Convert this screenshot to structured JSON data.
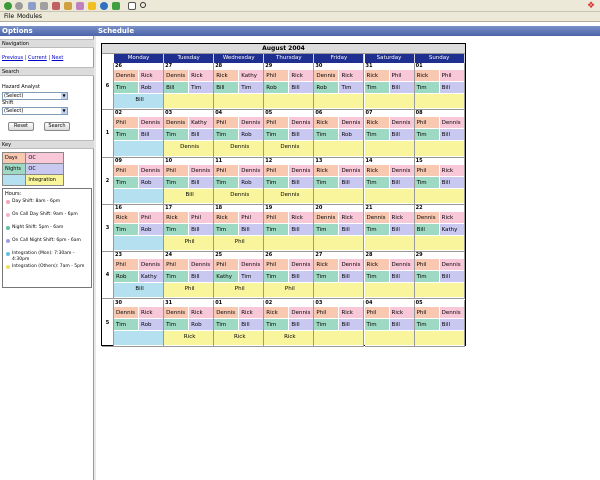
{
  "menu": {
    "file": "File",
    "modules": "Modules"
  },
  "left": {
    "header": "Options",
    "navigation": {
      "title": "Navigation",
      "previous": "Previous",
      "sep1": " | ",
      "current": "Current",
      "sep2": " | ",
      "next": "Next"
    },
    "search": {
      "title": "Search",
      "analyst_label": "Hazard Analyst",
      "analyst_value": "(Select)",
      "shift_label": "Shift",
      "shift_value": "(Select)",
      "reset_label": "Reset",
      "search_label": "Search"
    },
    "key": {
      "title": "Key",
      "rows": [
        [
          "Days",
          "OC"
        ],
        [
          "Nights",
          "OC"
        ],
        [
          "",
          "Integration"
        ]
      ]
    },
    "hours": {
      "title": "Hours:",
      "items": [
        {
          "label": "Day Shift: 8am - 6pm",
          "color": "#f4a6b8"
        },
        {
          "label": "On Call Day Shift: 9am - 6pm",
          "color": "#f4b4c4"
        },
        {
          "label": "Night Shift: 5pm - 6am",
          "color": "#5fbfa0"
        },
        {
          "label": "On Call Night Shift: 6pm - 6am",
          "color": "#9f9fe0"
        },
        {
          "label": "Integration (Mon): 7:30am - 4:30pm",
          "color": "#66c0e0"
        },
        {
          "label": "Integration (Others): 7am - 5pm",
          "color": "#f0e060"
        }
      ]
    }
  },
  "main": {
    "header": "Schedule",
    "calendar_title": "August 2004",
    "days": [
      "Monday",
      "Tuesday",
      "Wednesday",
      "Thursday",
      "Friday",
      "Saturday",
      "Sunday"
    ],
    "weeks": [
      {
        "week": "6",
        "dates": [
          "26",
          "27",
          "28",
          "29",
          "30",
          "31",
          "01"
        ],
        "rows": [
          [
            [
              "Dennis",
              "Rick"
            ],
            [
              "Dennis",
              "Rick"
            ],
            [
              "Rick",
              "Kathy"
            ],
            [
              "Phil",
              "Rick"
            ],
            [
              "Dennis",
              "Rick"
            ],
            [
              "Rick",
              "Phil"
            ],
            [
              "Rick",
              "Phil"
            ]
          ],
          [
            [
              "Tim",
              "Rob"
            ],
            [
              "Bill",
              "Tim"
            ],
            [
              "Bill",
              "Tim"
            ],
            [
              "Rob",
              "Bill"
            ],
            [
              "Rob",
              "Tim"
            ],
            [
              "Tim",
              "Bill"
            ],
            [
              "Tim",
              "Bill"
            ]
          ]
        ],
        "integration": [
          "Bill",
          "",
          "",
          "",
          "",
          "",
          ""
        ]
      },
      {
        "week": "1",
        "dates": [
          "02",
          "03",
          "04",
          "05",
          "06",
          "07",
          "08"
        ],
        "rows": [
          [
            [
              "Phil",
              "Dennis"
            ],
            [
              "Dennis",
              "Kathy"
            ],
            [
              "Phil",
              "Dennis"
            ],
            [
              "Phil",
              "Dennis"
            ],
            [
              "Rick",
              "Dennis"
            ],
            [
              "Rick",
              "Dennis"
            ],
            [
              "Phil",
              "Dennis"
            ]
          ],
          [
            [
              "Tim",
              "Bill"
            ],
            [
              "Tim",
              "Bill"
            ],
            [
              "Tim",
              "Rob"
            ],
            [
              "Tim",
              "Bill"
            ],
            [
              "Tim",
              "Rob"
            ],
            [
              "Tim",
              "Bill"
            ],
            [
              "Tim",
              "Bill"
            ]
          ]
        ],
        "integration": [
          "",
          "Dennis",
          "Dennis",
          "Dennis",
          "",
          "",
          ""
        ]
      },
      {
        "week": "2",
        "dates": [
          "09",
          "10",
          "11",
          "12",
          "13",
          "14",
          "15"
        ],
        "rows": [
          [
            [
              "Phil",
              "Dennis"
            ],
            [
              "Phil",
              "Dennis"
            ],
            [
              "Phil",
              "Dennis"
            ],
            [
              "Phil",
              "Dennis"
            ],
            [
              "Rick",
              "Dennis"
            ],
            [
              "Rick",
              "Dennis"
            ],
            [
              "Phil",
              "Rick"
            ]
          ],
          [
            [
              "Tim",
              "Rob"
            ],
            [
              "Tim",
              "Bill"
            ],
            [
              "Tim",
              "Rob"
            ],
            [
              "Tim",
              "Bill"
            ],
            [
              "Tim",
              "Bill"
            ],
            [
              "Tim",
              "Bill"
            ],
            [
              "Tim",
              "Bill"
            ]
          ]
        ],
        "integration": [
          "",
          "Bill",
          "Dennis",
          "Dennis",
          "",
          "",
          ""
        ]
      },
      {
        "week": "3",
        "dates": [
          "16",
          "17",
          "18",
          "19",
          "20",
          "21",
          "22"
        ],
        "rows": [
          [
            [
              "Rick",
              "Phil"
            ],
            [
              "Rick",
              "Phil"
            ],
            [
              "Rick",
              "Phil"
            ],
            [
              "Phil",
              "Rick"
            ],
            [
              "Dennis",
              "Rick"
            ],
            [
              "Dennis",
              "Rick"
            ],
            [
              "Dennis",
              "Rick"
            ]
          ],
          [
            [
              "Tim",
              "Rob"
            ],
            [
              "Tim",
              "Bill"
            ],
            [
              "Tim",
              "Bill"
            ],
            [
              "Tim",
              "Bill"
            ],
            [
              "Tim",
              "Bill"
            ],
            [
              "Tim",
              "Bill"
            ],
            [
              "Bill",
              "Kathy"
            ]
          ]
        ],
        "integration": [
          "",
          "Phil",
          "Phil",
          "",
          "",
          "",
          ""
        ]
      },
      {
        "week": "4",
        "dates": [
          "23",
          "24",
          "25",
          "26",
          "27",
          "28",
          "29"
        ],
        "rows": [
          [
            [
              "Phil",
              "Dennis"
            ],
            [
              "Phil",
              "Dennis"
            ],
            [
              "Phil",
              "Dennis"
            ],
            [
              "Phil",
              "Dennis"
            ],
            [
              "Rick",
              "Dennis"
            ],
            [
              "Rick",
              "Dennis"
            ],
            [
              "Phil",
              "Dennis"
            ]
          ],
          [
            [
              "Rob",
              "Kathy"
            ],
            [
              "Tim",
              "Bill"
            ],
            [
              "Kathy",
              "Tim"
            ],
            [
              "Tim",
              "Bill"
            ],
            [
              "Tim",
              "Bill"
            ],
            [
              "Tim",
              "Bill"
            ],
            [
              "Tim",
              "Bill"
            ]
          ]
        ],
        "integration": [
          "Bill",
          "Phil",
          "Phil",
          "Phil",
          "",
          "",
          ""
        ]
      },
      {
        "week": "5",
        "dates": [
          "30",
          "31",
          "01",
          "02",
          "03",
          "04",
          "05"
        ],
        "rows": [
          [
            [
              "Dennis",
              "Rick"
            ],
            [
              "Dennis",
              "Rick"
            ],
            [
              "Dennis",
              "Rick"
            ],
            [
              "Rick",
              "Dennis"
            ],
            [
              "Phil",
              "Rick"
            ],
            [
              "Phil",
              "Rick"
            ],
            [
              "Phil",
              "Dennis"
            ]
          ],
          [
            [
              "Tim",
              "Rob"
            ],
            [
              "Tim",
              "Rob"
            ],
            [
              "Tim",
              "Bill"
            ],
            [
              "Tim",
              "Bill"
            ],
            [
              "Tim",
              "Bill"
            ],
            [
              "Tim",
              "Bill"
            ],
            [
              "Tim",
              "Bill"
            ]
          ]
        ],
        "integration": [
          "",
          "Rick",
          "Rick",
          "Rick",
          "",
          "",
          ""
        ]
      }
    ]
  }
}
